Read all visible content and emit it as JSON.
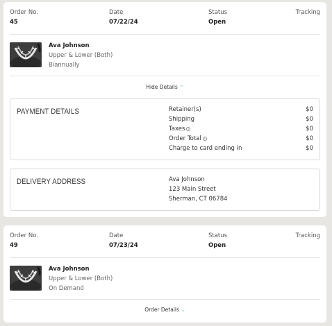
{
  "orders": [
    {
      "header": {
        "order_no_label": "Order No.",
        "order_no": "45",
        "date_label": "Date",
        "date": "07/22/24",
        "status_label": "Status",
        "status": "Open",
        "tracking_label": "Tracking"
      },
      "item": {
        "name": "Ava Johnson",
        "type": "Upper & Lower (Both)",
        "frequency": "Biannually"
      },
      "toggle_label": "Hide Details",
      "toggle_icon": "chevron-up-icon",
      "payment": {
        "title": "PAYMENT DETAILS",
        "rows": [
          {
            "label": "Retainer(s)",
            "amount": "$0"
          },
          {
            "label": "Shipping",
            "amount": "$0"
          },
          {
            "label": "Taxes",
            "amount": "$0",
            "info_icon": "info-icon"
          },
          {
            "label": "Order Total",
            "amount": "$0",
            "info_icon": "info-icon"
          },
          {
            "label": "Charge to card ending in",
            "amount": "$0"
          }
        ]
      },
      "delivery": {
        "title": "DELIVERY ADDRESS",
        "name": "Ava Johnson",
        "street": "123 Main Street",
        "city": "Sherman, CT 06784"
      }
    },
    {
      "header": {
        "order_no_label": "Order No.",
        "order_no": "49",
        "date_label": "Date",
        "date": "07/23/24",
        "status_label": "Status",
        "status": "Open",
        "tracking_label": "Tracking"
      },
      "item": {
        "name": "Ava Johnson",
        "type": "Upper & Lower (Both)",
        "frequency": "On Demand"
      },
      "toggle_label": "Order Details",
      "toggle_icon": "chevron-down-icon"
    }
  ],
  "colors": {
    "accent": "#6fb2a6",
    "page_background": "#e8e6e3",
    "card_background": "#ffffff"
  }
}
